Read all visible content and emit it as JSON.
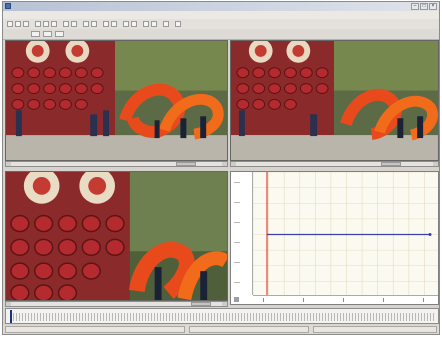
{
  "window": {
    "title": "",
    "controls": [
      "–",
      "□",
      "×"
    ]
  },
  "menubar": {
    "items": []
  },
  "subbar": {
    "label": ""
  },
  "panes": {
    "top_left": {
      "name": "video-view-1"
    },
    "top_right": {
      "name": "video-view-2"
    },
    "bottom_left": {
      "name": "video-view-3"
    }
  },
  "graph": {
    "chart_data": {
      "type": "line",
      "title": "",
      "xlabel": "",
      "ylabel": "",
      "marker_x": 0,
      "series": [
        {
          "values": [
            0.5,
            0.5
          ]
        }
      ]
    }
  },
  "timeline": {
    "position": 0.0
  },
  "colors": {
    "accent": "#1a2f8a",
    "marker": "#e0403a",
    "series": "#3b3fa8",
    "grid": "#e2dcc0"
  }
}
